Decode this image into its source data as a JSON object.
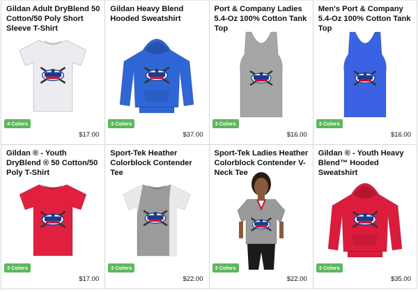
{
  "products": [
    {
      "title": "Gildan Adult DryBlend 50 Cotton/50 Poly Short Sleeve T-Shirt",
      "colors": "4 Colors",
      "price": "$17.00",
      "garment": "tshirt",
      "color": "#ececf0",
      "icon": "white-tshirt-icon"
    },
    {
      "title": "Gildan Heavy Blend Hooded Sweatshirt",
      "colors": "3 Colors",
      "price": "$37.00",
      "garment": "hoodie",
      "color": "#2f66d6",
      "icon": "blue-hoodie-icon"
    },
    {
      "title": "Port & Company Ladies 5.4-Oz 100% Cotton Tank Top",
      "colors": "3 Colors",
      "price": "$16.00",
      "garment": "tank",
      "color": "#a6a6a6",
      "icon": "grey-tank-top-icon"
    },
    {
      "title": "Men's Port & Company 5.4-Oz 100% Cotton Tank Top",
      "colors": "3 Colors",
      "price": "$16.00",
      "garment": "tank",
      "color": "#3b62e2",
      "icon": "blue-tank-top-icon"
    },
    {
      "title": "Gildan ® - Youth DryBlend ® 50 Cotton/50 Poly T-Shirt",
      "colors": "3 Colors",
      "price": "$17.00",
      "garment": "tshirt",
      "color": "#e0203e",
      "icon": "red-tshirt-icon"
    },
    {
      "title": "Sport-Tek Heather Colorblock Contender Tee",
      "colors": "3 Colors",
      "price": "$22.00",
      "garment": "colorblock",
      "color": "#9b9b9b",
      "icon": "grey-colorblock-tee-icon"
    },
    {
      "title": "Sport-Tek Ladies Heather Colorblock Contender V-Neck Tee",
      "colors": "3 Colors",
      "price": "$22.00",
      "garment": "model",
      "color": "#9a9a9a",
      "icon": "model-vneck-tee-icon"
    },
    {
      "title": "Gildan ® - Youth Heavy Blend™ Hooded Sweatshirt",
      "colors": "3 Colors",
      "price": "$35.00",
      "garment": "hoodie",
      "color": "#dc1c3c",
      "icon": "red-hoodie-icon"
    }
  ],
  "colors": {
    "badge": "#5cb85c",
    "logo_blue": "#1e3a8a",
    "logo_red": "#c8102e"
  }
}
